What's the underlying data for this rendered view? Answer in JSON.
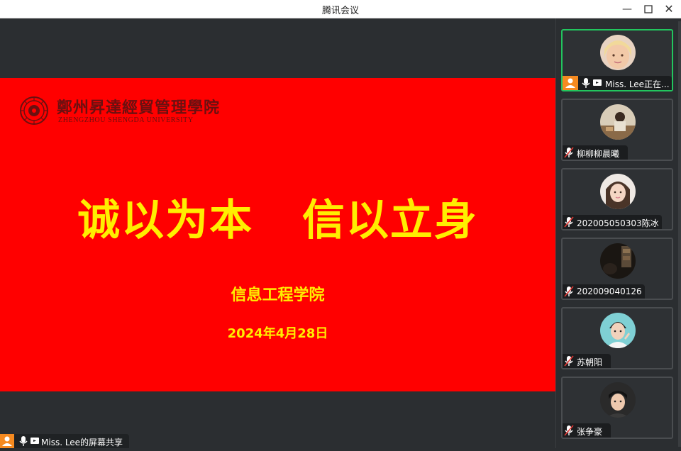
{
  "window": {
    "title": "腾讯会议",
    "minimize_label": "—",
    "maximize_label": "☐",
    "close_label": "✕"
  },
  "slide": {
    "logo_cn": "鄭州昇達經貿管理學院",
    "logo_en": "ZHENGZHOU SHENGDA UNIVERSITY",
    "slogan": "诚以为本   信以立身",
    "department": "信息工程学院",
    "date": "2024年4月28日",
    "background_color": "#ff0000",
    "text_color": "#ffee00"
  },
  "share_bar": {
    "label": "Miss. Lee的屏幕共享",
    "icons": [
      "user-role-icon",
      "mic-icon",
      "screen-share-icon"
    ]
  },
  "participants": [
    {
      "name": "Miss. Lee正在...",
      "active": true,
      "avatar": "blonde-woman",
      "muted": false
    },
    {
      "name": "柳柳柳晨曦",
      "active": false,
      "avatar": "tea-scene",
      "muted": true
    },
    {
      "name": "202005050303陈冰",
      "active": false,
      "avatar": "long-hair-girl",
      "muted": true
    },
    {
      "name": "202009040126",
      "active": false,
      "avatar": "dark-photo",
      "muted": true
    },
    {
      "name": "苏朝阳",
      "active": false,
      "avatar": "boy-teal-bg",
      "muted": true
    },
    {
      "name": "张争豪",
      "active": false,
      "avatar": "boy-portrait",
      "muted": true
    }
  ],
  "colors": {
    "active_border": "#22c55e",
    "host_badge": "#f58a20",
    "panel_bg": "#2b2e31"
  }
}
